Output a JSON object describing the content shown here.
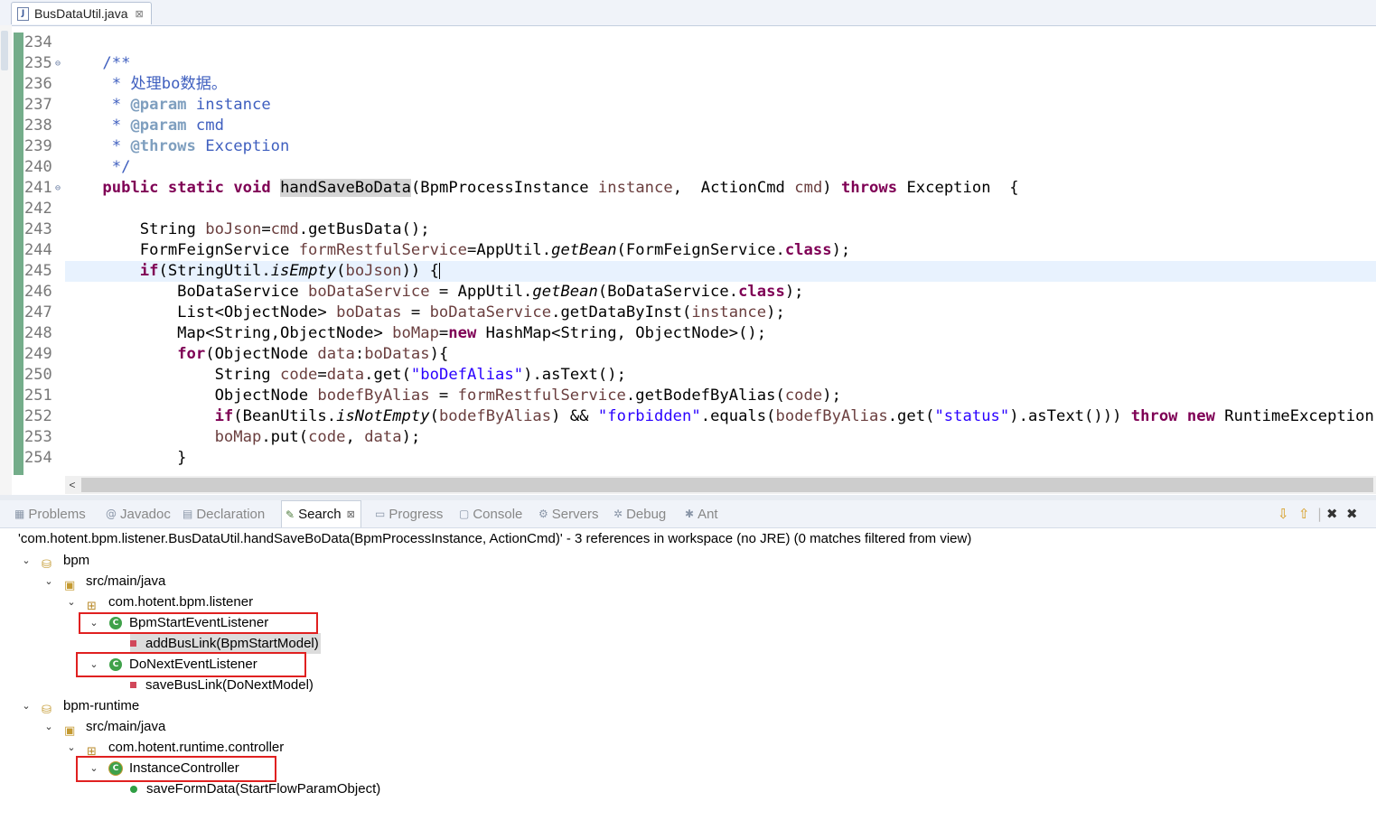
{
  "editor": {
    "tab_title": "BusDataUtil.java",
    "tab_close": "⊠",
    "line_numbers": [
      "234",
      "235",
      "236",
      "237",
      "238",
      "239",
      "240",
      "241",
      "242",
      "243",
      "244",
      "245",
      "246",
      "247",
      "248",
      "249",
      "250",
      "251",
      "252",
      "253",
      "254"
    ],
    "fold_marker": "⊖"
  },
  "panel": {
    "tabs": {
      "problems": "Problems",
      "javadoc": "Javadoc",
      "declaration": "Declaration",
      "search": "Search",
      "progress": "Progress",
      "console": "Console",
      "servers": "Servers",
      "debug": "Debug",
      "ant": "Ant"
    },
    "search_close": "⊠",
    "summary": "'com.hotent.bpm.listener.BusDataUtil.handSaveBoData(BpmProcessInstance, ActionCmd)' - 3 references in workspace (no JRE) (0 matches filtered from view)",
    "tree": {
      "project1": "bpm",
      "src1": "src/main/java",
      "pkg1": "com.hotent.bpm.listener",
      "class1": "BpmStartEventListener",
      "method1": "addBusLink(BpmStartModel)",
      "class2": "DoNextEventListener",
      "method2": "saveBusLink(DoNextModel)",
      "project2": "bpm-runtime",
      "src2": "src/main/java",
      "pkg2": "com.hotent.runtime.controller",
      "class3": "InstanceController",
      "method3": "saveFormData(StartFlowParamObject)"
    }
  },
  "icons": {
    "java_file": "J",
    "class": "C",
    "expand": "⌄",
    "collapse_left": "<"
  }
}
